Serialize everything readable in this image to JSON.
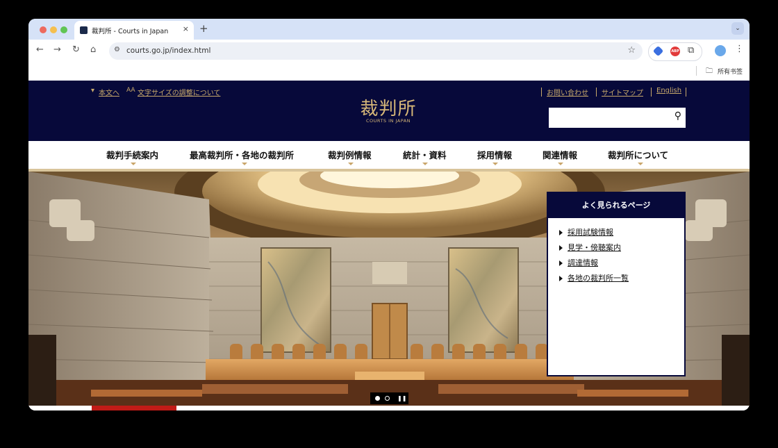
{
  "browser": {
    "tab_title": "裁判所 - Courts in Japan",
    "tab_close": "×",
    "new_tab": "+",
    "tab_menu": "⌄",
    "back": "←",
    "forward": "→",
    "reload": "↻",
    "home": "⌂",
    "url": "courts.go.jp/index.html",
    "bookmark_star": "☆",
    "abp_label": "ABP",
    "bookmarks_folder": "所有书签",
    "menu": "⋮",
    "traffic_colors": [
      "#ed6a5e",
      "#f5bf4f",
      "#61c554"
    ]
  },
  "header": {
    "skip_link": "本文へ",
    "font_size_link": "文字サイズの調整について",
    "contact_link": "お問い合わせ",
    "sitemap_link": "サイトマップ",
    "english_link": "English",
    "logo_text": "裁判所",
    "logo_subtext": "COURTS IN JAPAN",
    "search_placeholder": "",
    "accent_color": "#c9aa6b",
    "header_bg": "#07093a"
  },
  "nav": {
    "items": [
      {
        "label": "裁判手続案内"
      },
      {
        "label": "最高裁判所・各地の裁判所"
      },
      {
        "label": "裁判例情報"
      },
      {
        "label": "統計・資料"
      },
      {
        "label": "採用情報"
      },
      {
        "label": "関連情報"
      },
      {
        "label": "裁判所について"
      }
    ]
  },
  "popular": {
    "title": "よく見られるページ",
    "links": [
      "採用試験情報",
      "見学・傍聴案内",
      "調達情報",
      "各地の裁判所一覧"
    ]
  },
  "slideshow": {
    "pause_icon": "❚❚"
  }
}
